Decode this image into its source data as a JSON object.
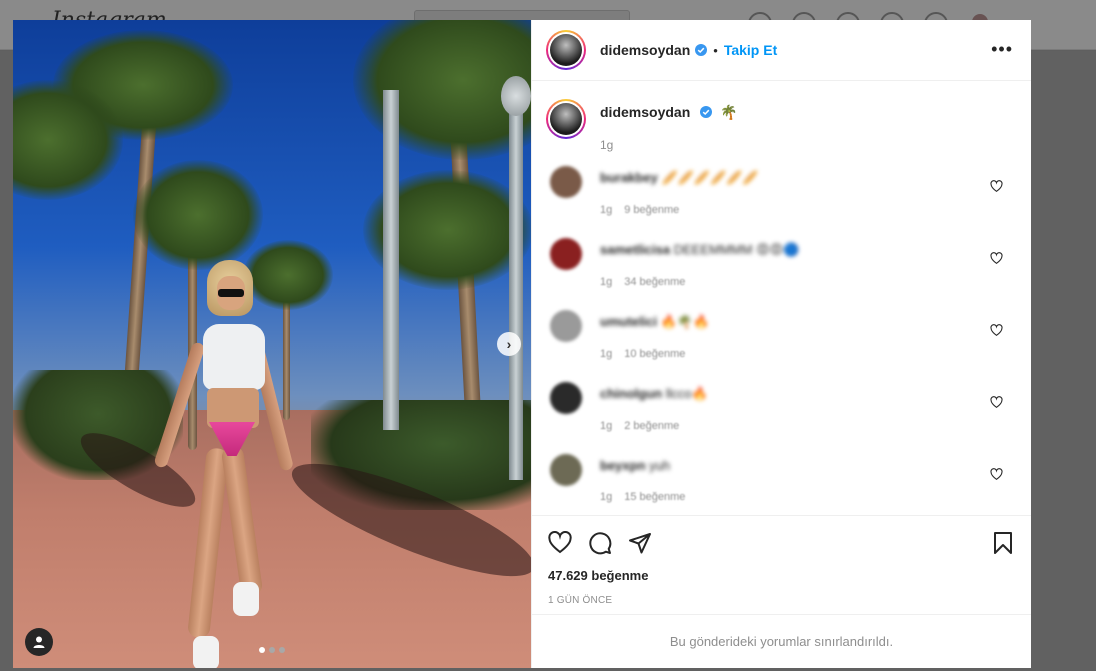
{
  "background": {
    "logo": "Instagram"
  },
  "post": {
    "username": "didemsoydan",
    "follow_label": "Takip Et",
    "separator": "•",
    "more_label": "•••",
    "caption_emoji": "🌴",
    "caption_time": "1g",
    "likes": "47.629 beğenme",
    "posted": "1 gün önce",
    "restricted_notice": "Bu gönderideki yorumlar sınırlandırıldı.",
    "carousel": {
      "total": 3,
      "active": 1
    }
  },
  "comments": [
    {
      "user": "burakbey",
      "text": "🥖🥖🥖🥖🥖🥖",
      "time": "1g",
      "likes": "9 beğenme",
      "avatar_color": "#7a5a48"
    },
    {
      "user": "sametlicisa",
      "text": "DEEEMMMM 😡😡🔵",
      "time": "1g",
      "likes": "34 beğenme",
      "avatar_color": "#8a2020"
    },
    {
      "user": "umutelici",
      "text": "🔥🌴🔥",
      "time": "1g",
      "likes": "10 beğenme",
      "avatar_color": "#9a9a9a"
    },
    {
      "user": "chinolgun",
      "text": "llcco🔥",
      "time": "1g",
      "likes": "2 beğenme",
      "avatar_color": "#2a2a2a"
    },
    {
      "user": "beyxpn",
      "text": "yuh",
      "time": "1g",
      "likes": "15 beğenme",
      "avatar_color": "#6d6a55"
    }
  ],
  "colors": {
    "accent": "#0095f6",
    "verified": "#3897f0",
    "text": "#262626",
    "muted": "#8e8e8e"
  }
}
